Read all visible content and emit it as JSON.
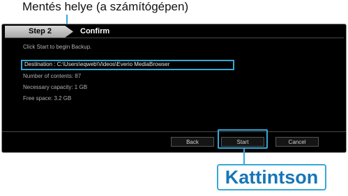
{
  "callout": {
    "save_location": "Mentés helye (a számítógépen)",
    "click": "Kattintson"
  },
  "dialog": {
    "step_label": "Step 2",
    "title": "Confirm",
    "intro": "Click Start to begin Backup.",
    "destination": "Destination : C:\\Users\\eqweb\\Videos\\Everio MediaBrowser",
    "number_of_contents": "Number of contents: 87",
    "necessary_capacity": "Necessary capacity: 1 GB",
    "free_space": "Free space: 3.2 GB",
    "buttons": {
      "back": "Back",
      "start": "Start",
      "cancel": "Cancel"
    }
  },
  "colors": {
    "accent": "#34a8d8",
    "callout_text": "#1676b8"
  }
}
